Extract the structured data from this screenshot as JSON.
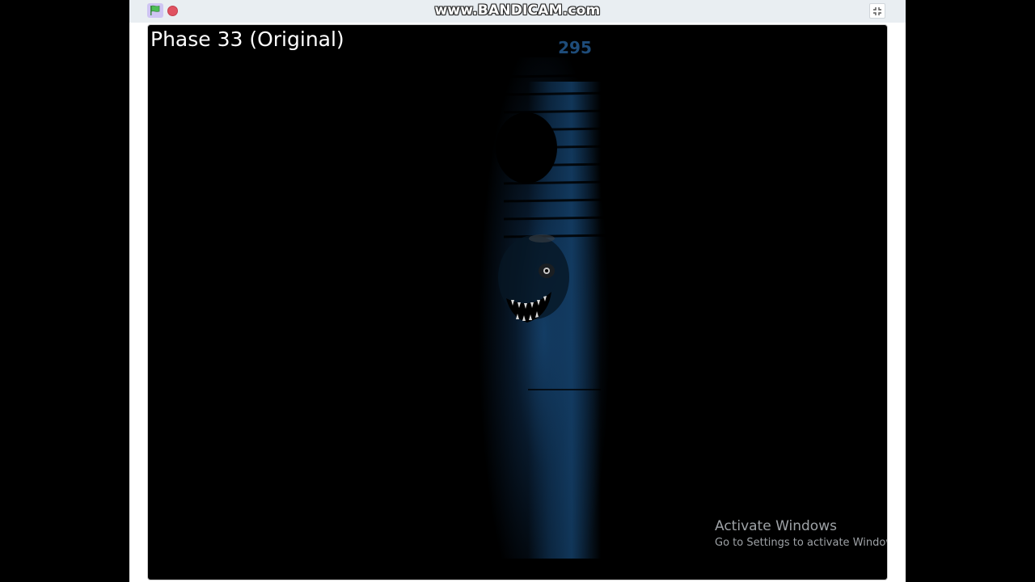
{
  "recording": {
    "watermark": "www.BANDICAM.com"
  },
  "controls": {
    "green_flag_icon": "green-flag-icon",
    "stop_icon": "stop-sign-icon",
    "fullscreen_icon": "exit-fullscreen-icon"
  },
  "stage": {
    "phase_title": "Phase 33 (Original)",
    "score": "295"
  },
  "os_notice": {
    "title": "Activate Windows",
    "subtitle": "Go to Settings to activate Windows."
  },
  "colors": {
    "stage_background": "#000000",
    "light_blue": "#1e4c7a",
    "controls_bar": "#e9eef2",
    "stop_red": "#e05261",
    "flag_green": "#4cbf56"
  }
}
